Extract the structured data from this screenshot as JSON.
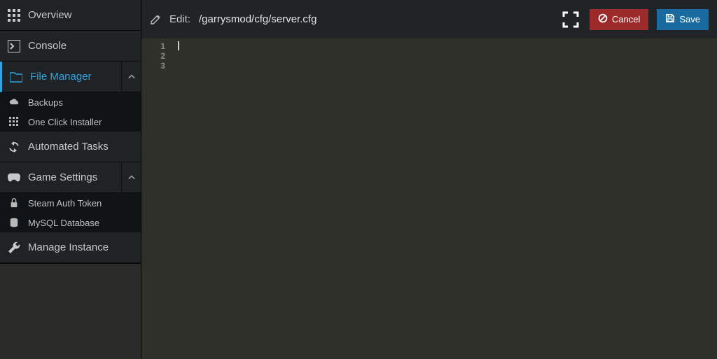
{
  "sidebar": {
    "overview": "Overview",
    "console": "Console",
    "file_manager": "File Manager",
    "file_manager_sub": {
      "backups": "Backups",
      "one_click": "One Click Installer"
    },
    "automated_tasks": "Automated Tasks",
    "game_settings": "Game Settings",
    "game_settings_sub": {
      "steam_auth": "Steam Auth Token",
      "mysql": "MySQL Database"
    },
    "manage_instance": "Manage Instance"
  },
  "toolbar": {
    "edit_label": "Edit:",
    "path": "/garrysmod/cfg/server.cfg",
    "cancel": "Cancel",
    "save": "Save"
  },
  "editor": {
    "lines": [
      "1",
      "2",
      "3"
    ],
    "content": ""
  }
}
